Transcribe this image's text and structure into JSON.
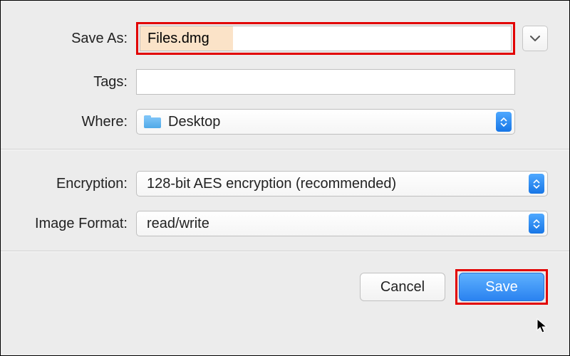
{
  "form": {
    "save_as_label": "Save As:",
    "save_as_value": "Files.dmg",
    "tags_label": "Tags:",
    "tags_value": "",
    "where_label": "Where:",
    "where_value": "Desktop"
  },
  "options": {
    "encryption_label": "Encryption:",
    "encryption_value": "128-bit AES encryption (recommended)",
    "image_format_label": "Image Format:",
    "image_format_value": "read/write"
  },
  "buttons": {
    "cancel": "Cancel",
    "save": "Save"
  }
}
